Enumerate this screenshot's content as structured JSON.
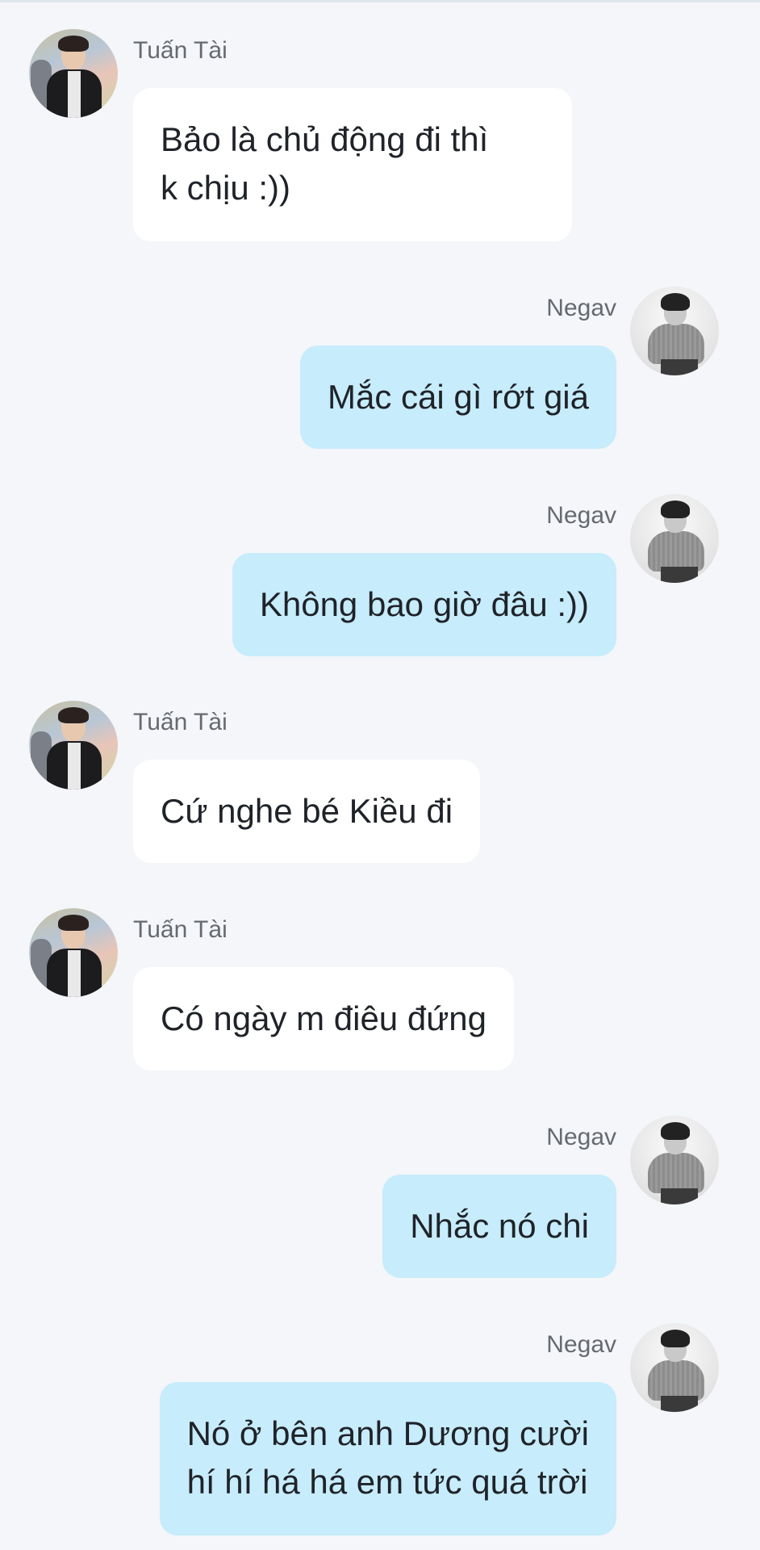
{
  "messages": [
    {
      "direction": "in",
      "sender": "Tuấn Tài",
      "lines": [
        "Bảo là chủ động đi thì",
        "k chịu :))"
      ],
      "avatar": "tuan-tai-avatar"
    },
    {
      "direction": "out",
      "sender": "Negav",
      "lines": [
        "Mắc cái gì rớt giá"
      ],
      "avatar": "negav-avatar"
    },
    {
      "direction": "out",
      "sender": "Negav",
      "lines": [
        "Không bao giờ đâu :))"
      ],
      "avatar": "negav-avatar"
    },
    {
      "direction": "in",
      "sender": "Tuấn Tài",
      "lines": [
        "Cứ nghe bé Kiều đi"
      ],
      "avatar": "tuan-tai-avatar"
    },
    {
      "direction": "in",
      "sender": "Tuấn Tài",
      "lines": [
        "Có ngày m điêu đứng"
      ],
      "avatar": "tuan-tai-avatar"
    },
    {
      "direction": "out",
      "sender": "Negav",
      "lines": [
        "Nhắc nó chi"
      ],
      "avatar": "negav-avatar"
    },
    {
      "direction": "out",
      "sender": "Negav",
      "lines": [
        "Nó ở bên anh Dương cười",
        "hí hí há há em tức quá trời"
      ],
      "avatar": "negav-avatar"
    }
  ],
  "colors": {
    "background": "#f4f6f9",
    "incoming_bubble": "#ffffff",
    "outgoing_bubble": "#c7ecfb",
    "sender_text": "#666a70",
    "message_text": "#1f2329"
  }
}
